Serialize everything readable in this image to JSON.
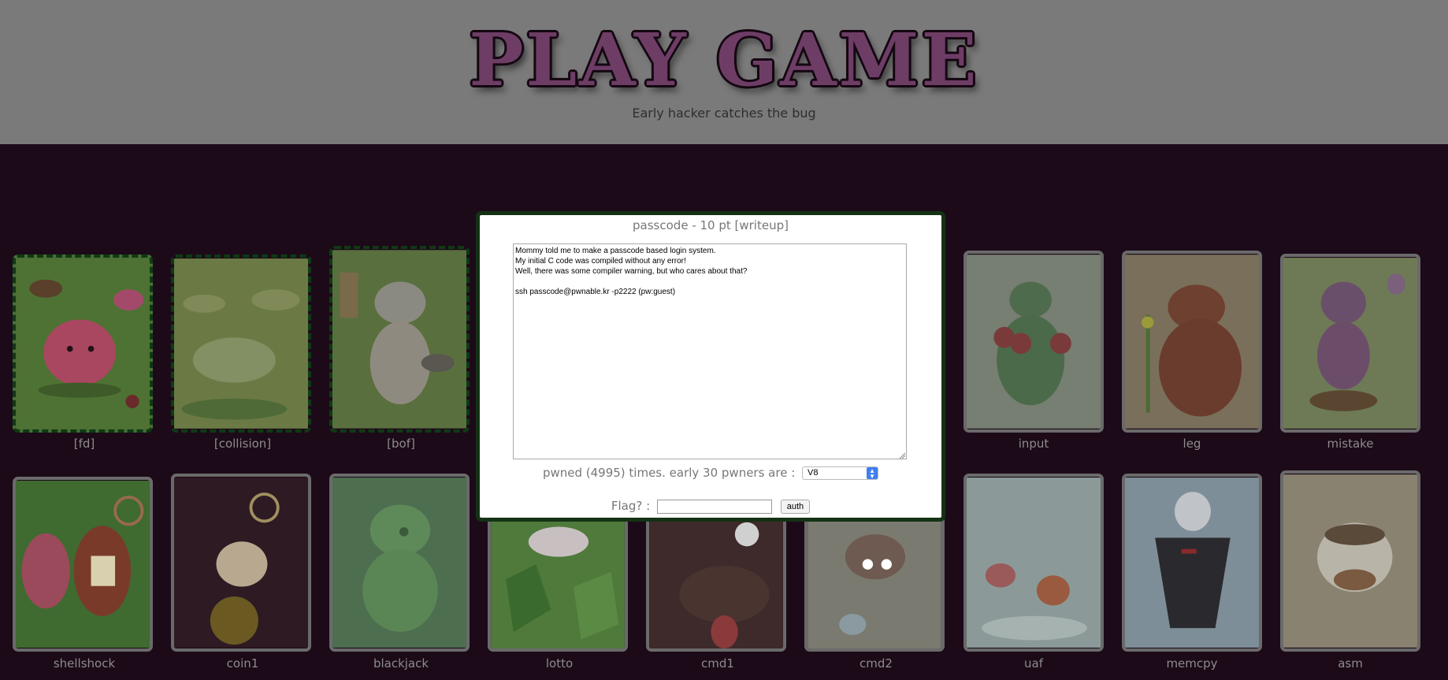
{
  "header": {
    "logo_text": "PLAY GAME",
    "tagline": "Early hacker catches the bug"
  },
  "cards": [
    {
      "name": "fd",
      "label": "[fd]",
      "solved": true
    },
    {
      "name": "collision",
      "label": "[collision]",
      "solved": true
    },
    {
      "name": "bof",
      "label": "[bof]",
      "solved": true
    },
    {
      "name": "input",
      "label": "input",
      "solved": false
    },
    {
      "name": "leg",
      "label": "leg",
      "solved": false
    },
    {
      "name": "mistake",
      "label": "mistake",
      "solved": false
    },
    {
      "name": "shellshock",
      "label": "shellshock",
      "solved": false
    },
    {
      "name": "coin1",
      "label": "coin1",
      "solved": false
    },
    {
      "name": "blackjack",
      "label": "blackjack",
      "solved": false
    },
    {
      "name": "lotto",
      "label": "lotto",
      "solved": false
    },
    {
      "name": "cmd1",
      "label": "cmd1",
      "solved": false
    },
    {
      "name": "cmd2",
      "label": "cmd2",
      "solved": false
    },
    {
      "name": "uaf",
      "label": "uaf",
      "solved": false
    },
    {
      "name": "memcpy",
      "label": "memcpy",
      "solved": false
    },
    {
      "name": "asm",
      "label": "asm",
      "solved": false
    }
  ],
  "modal": {
    "title": "passcode - 10 pt [writeup]",
    "description": "Mommy told me to make a passcode based login system.\nMy initial C code was compiled without any error!\nWell, there was some compiler warning, but who cares about that?\n\nssh passcode@pwnable.kr -p2222 (pw:guest)",
    "pwned_text": "pwned (4995) times. early 30 pwners are :",
    "pwner_selected": "V8",
    "flag_label": "Flag? :",
    "flag_value": "",
    "auth_label": "auth"
  },
  "colors": {
    "page_bg": "#1c0a19",
    "header_bg": "#7a7a7a",
    "logo_fill": "#6e3d66",
    "modal_border": "#143214",
    "select_accent": "#3f7ef0"
  }
}
